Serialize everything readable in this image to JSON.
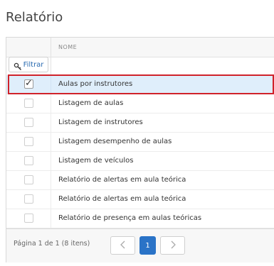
{
  "page": {
    "title": "Relatório"
  },
  "grid": {
    "column_header": "NOME",
    "filter": {
      "label": "Filtrar",
      "icon": "key-search-icon"
    },
    "rows": [
      {
        "name": "Aulas por instrutores",
        "checked": true,
        "selected": true
      },
      {
        "name": "Listagem de aulas",
        "checked": false,
        "selected": false
      },
      {
        "name": "Listagem de instrutores",
        "checked": false,
        "selected": false
      },
      {
        "name": "Listagem desempenho de aulas",
        "checked": false,
        "selected": false
      },
      {
        "name": "Listagem de veículos",
        "checked": false,
        "selected": false
      },
      {
        "name": "Relatório de alertas em aula teórica",
        "checked": false,
        "selected": false
      },
      {
        "name": "Relatório de alertas em aula teórica",
        "checked": false,
        "selected": false
      },
      {
        "name": "Relatório de presença em aulas teóricas",
        "checked": false,
        "selected": false
      }
    ]
  },
  "pager": {
    "info": "Página 1 de 1 (8 itens)",
    "current_page": "1",
    "prev_icon": "chevron-left-icon",
    "next_icon": "chevron-right-icon"
  },
  "colors": {
    "accent": "#2a73c7",
    "selected_row": "#dfeefb",
    "highlight_outline": "#d0222a",
    "link": "#2a6bb0"
  }
}
